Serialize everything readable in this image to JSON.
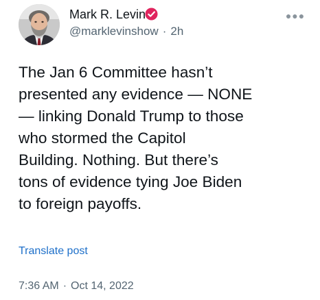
{
  "author": {
    "display_name": "Mark R. Levin",
    "handle": "@marklevinshow",
    "separator": "·",
    "time_ago": "2h"
  },
  "more_icon": "more-options-icon",
  "verified_icon": "verified-badge-icon",
  "post": {
    "text": "The Jan 6 Committee hasn’t\npresented any evidence — NONE\n— linking  Donald Trump to those\nwho stormed the Capitol\nBuilding.  Nothing. But there’s\ntons of evidence tying Joe Biden\nto foreign payoffs.",
    "translate_label": "Translate post"
  },
  "meta": {
    "time": "7:36 AM",
    "separator": "·",
    "date": "Oct 14, 2022"
  },
  "colors": {
    "text": "#0f1419",
    "secondary_text": "#536471",
    "link": "#1d6fc9",
    "verified_badge": "#e0245e"
  }
}
